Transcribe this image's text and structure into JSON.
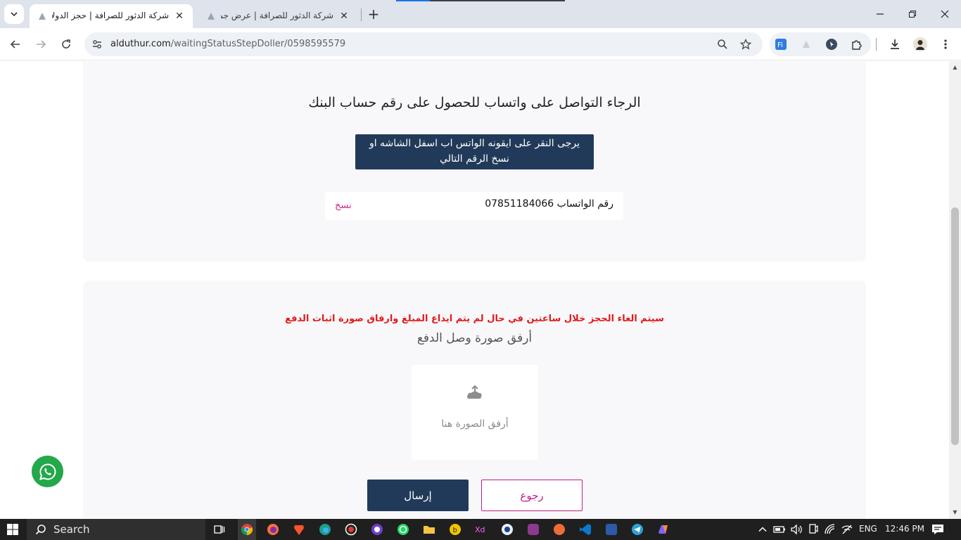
{
  "browser": {
    "tabs": [
      {
        "title": "شركة الدثور للصرافة | حجز الدولار",
        "active": true
      },
      {
        "title": "شركة الدثور للصرافة | عرض جميع",
        "active": false
      }
    ],
    "url_host": "alduthur.com",
    "url_path": "/waitingStatusStepDoller/0598595579"
  },
  "page": {
    "heading": "الرجاء التواصل على واتساب للحصول على رقم حساب البنك",
    "note": "يرجى النقر على ايقونه الواتس اب اسفل الشاشه او نسخ الرقم التالي",
    "phone_label": "رقم الواتساب 07851184066",
    "copy_label": "نسخ",
    "warning": "سيتم الغاء الحجز خلال ساعتين في حال لم يتم ايداع المبلغ وارفاق صورة اثبات الدفع",
    "attach_label": "أرفق صورة وصل الدفع",
    "upload_hint": "أرفق الصورة هنا",
    "send_label": "إرسال",
    "back_label": "رجوع"
  },
  "taskbar": {
    "search_label": "Search",
    "language": "ENG",
    "time": "12:46 PM"
  },
  "colors": {
    "primary": "#213a59",
    "accent": "#c21f84",
    "warning": "#e11b1b",
    "whatsapp": "#23a84a"
  }
}
